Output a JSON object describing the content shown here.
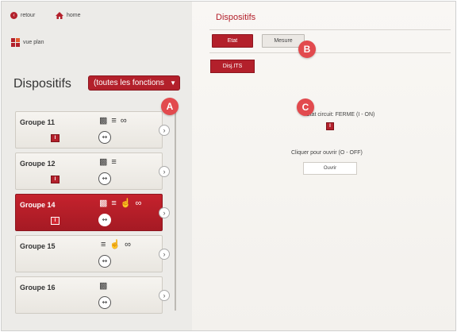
{
  "nav": {
    "back_label": "retour",
    "home_label": "home",
    "plan_label": "vue plan"
  },
  "page": {
    "title": "Dispositifs"
  },
  "left": {
    "title": "Dispositifs",
    "filter": {
      "selected": "(toutes les fonctions",
      "icon": "chevron-down-icon"
    }
  },
  "groups": [
    {
      "name": "Groupe 11",
      "state": "I",
      "icons": [
        "chart-icon",
        "traffic-light-icon",
        "link-icon"
      ],
      "active": false
    },
    {
      "name": "Groupe 12",
      "state": "I",
      "icons": [
        "chart-icon",
        "traffic-light-icon"
      ],
      "active": false
    },
    {
      "name": "Groupe 14",
      "state": "I",
      "icons": [
        "chart-icon",
        "traffic-light-icon",
        "hand-icon",
        "link-icon"
      ],
      "active": true
    },
    {
      "name": "Groupe 15",
      "state": "",
      "icons": [
        "traffic-light-icon",
        "hand-icon",
        "link-icon"
      ],
      "active": false
    },
    {
      "name": "Groupe 16",
      "state": "",
      "icons": [
        "chart-icon"
      ],
      "active": false
    }
  ],
  "tabs": {
    "etat": "Etat",
    "mesure": "Mesure"
  },
  "disj_button": "Disj.ITS",
  "status": {
    "line": "Etat circuit: FERME (I - ON)",
    "indicator": "I",
    "instruction": "Cliquer pour ouvrir (O - OFF)",
    "open_button": "Ouvrir"
  },
  "callouts": {
    "a": "A",
    "b": "B",
    "c": "C"
  },
  "colors": {
    "accent": "#b3202b",
    "callout": "#e24a4e"
  }
}
